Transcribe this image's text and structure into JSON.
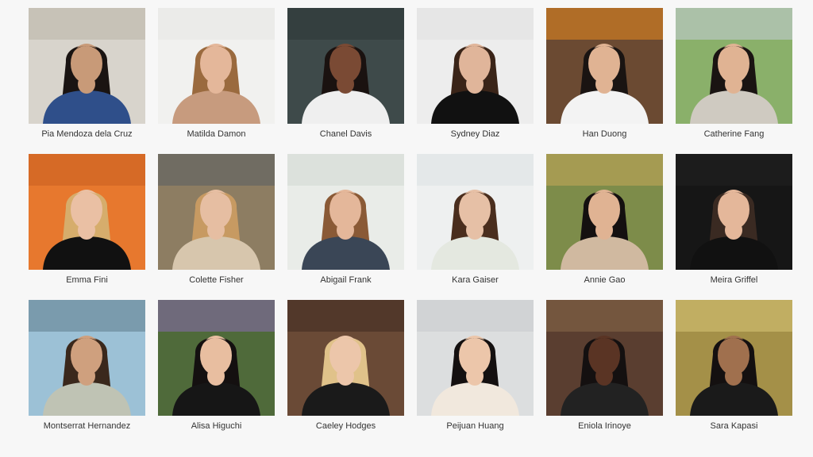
{
  "people": [
    {
      "name": "Pia Mendoza dela Cruz",
      "bg": "#d8d4cc",
      "accent": "#b9b2a5",
      "hair": "#1a1412",
      "skin": "#c89a78",
      "top": "#2f4f8a"
    },
    {
      "name": "Matilda Damon",
      "bg": "#f1f1ef",
      "accent": "#e6e6e4",
      "hair": "#9a6a3e",
      "skin": "#e4b79a",
      "top": "#c79b7e"
    },
    {
      "name": "Chanel Davis",
      "bg": "#3e4a4a",
      "accent": "#2c3636",
      "hair": "#1a1210",
      "skin": "#7a4a34",
      "top": "#efefef"
    },
    {
      "name": "Sydney Diaz",
      "bg": "#ededed",
      "accent": "#e0e0e0",
      "hair": "#3a2418",
      "skin": "#e0b59a",
      "top": "#111111"
    },
    {
      "name": "Han Duong",
      "bg": "#6b4a32",
      "accent": "#e98a1f",
      "hair": "#1a1412",
      "skin": "#e0b393",
      "top": "#f3f3f3"
    },
    {
      "name": "Catherine Fang",
      "bg": "#8ab06a",
      "accent": "#c7d0da",
      "hair": "#1a1412",
      "skin": "#e0b393",
      "top": "#cfcac1"
    },
    {
      "name": "Emma Fini",
      "bg": "#e7782e",
      "accent": "#c95f20",
      "hair": "#d6ad6c",
      "skin": "#eac0a4",
      "top": "#111111"
    },
    {
      "name": "Colette Fisher",
      "bg": "#8d7d62",
      "accent": "#5a5e62",
      "hair": "#c79a62",
      "skin": "#e6bea2",
      "top": "#d7c6ad"
    },
    {
      "name": "Abigail Frank",
      "bg": "#e9ece8",
      "accent": "#d2d8d2",
      "hair": "#8a5a36",
      "skin": "#e4b79a",
      "top": "#3a4656"
    },
    {
      "name": "Kara Gaiser",
      "bg": "#eef0f0",
      "accent": "#dde2e3",
      "hair": "#4a2e1e",
      "skin": "#e6c0a6",
      "top": "#e4e8e0"
    },
    {
      "name": "Annie Gao",
      "bg": "#7d8c4a",
      "accent": "#c7a85a",
      "hair": "#141010",
      "skin": "#e0b393",
      "top": "#d0b9a0"
    },
    {
      "name": "Meira Griffel",
      "bg": "#161616",
      "accent": "#222222",
      "hair": "#3a2a22",
      "skin": "#e4b79a",
      "top": "#111111"
    },
    {
      "name": "Montserrat Hernandez",
      "bg": "#9cc1d6",
      "accent": "#5e7c8c",
      "hair": "#3a281c",
      "skin": "#cfa07e",
      "top": "#bfc3b4"
    },
    {
      "name": "Alisa Higuchi",
      "bg": "#4f6a3a",
      "accent": "#8a6ab0",
      "hair": "#141010",
      "skin": "#e8bea0",
      "top": "#161616"
    },
    {
      "name": "Caeley Hodges",
      "bg": "#6a4a36",
      "accent": "#3e2a20",
      "hair": "#e0c28a",
      "skin": "#ecc6aa",
      "top": "#1a1a1a"
    },
    {
      "name": "Peijuan Huang",
      "bg": "#dcdedf",
      "accent": "#c8cacc",
      "hair": "#141010",
      "skin": "#ecc6aa",
      "top": "#f1e8dd"
    },
    {
      "name": "Eniola Irinoye",
      "bg": "#5a3e30",
      "accent": "#8a6a4a",
      "hair": "#141010",
      "skin": "#5a3424",
      "top": "#222222"
    },
    {
      "name": "Sara Kapasi",
      "bg": "#a49048",
      "accent": "#d8c678",
      "hair": "#141010",
      "skin": "#a0704e",
      "top": "#1a1a1a"
    }
  ]
}
